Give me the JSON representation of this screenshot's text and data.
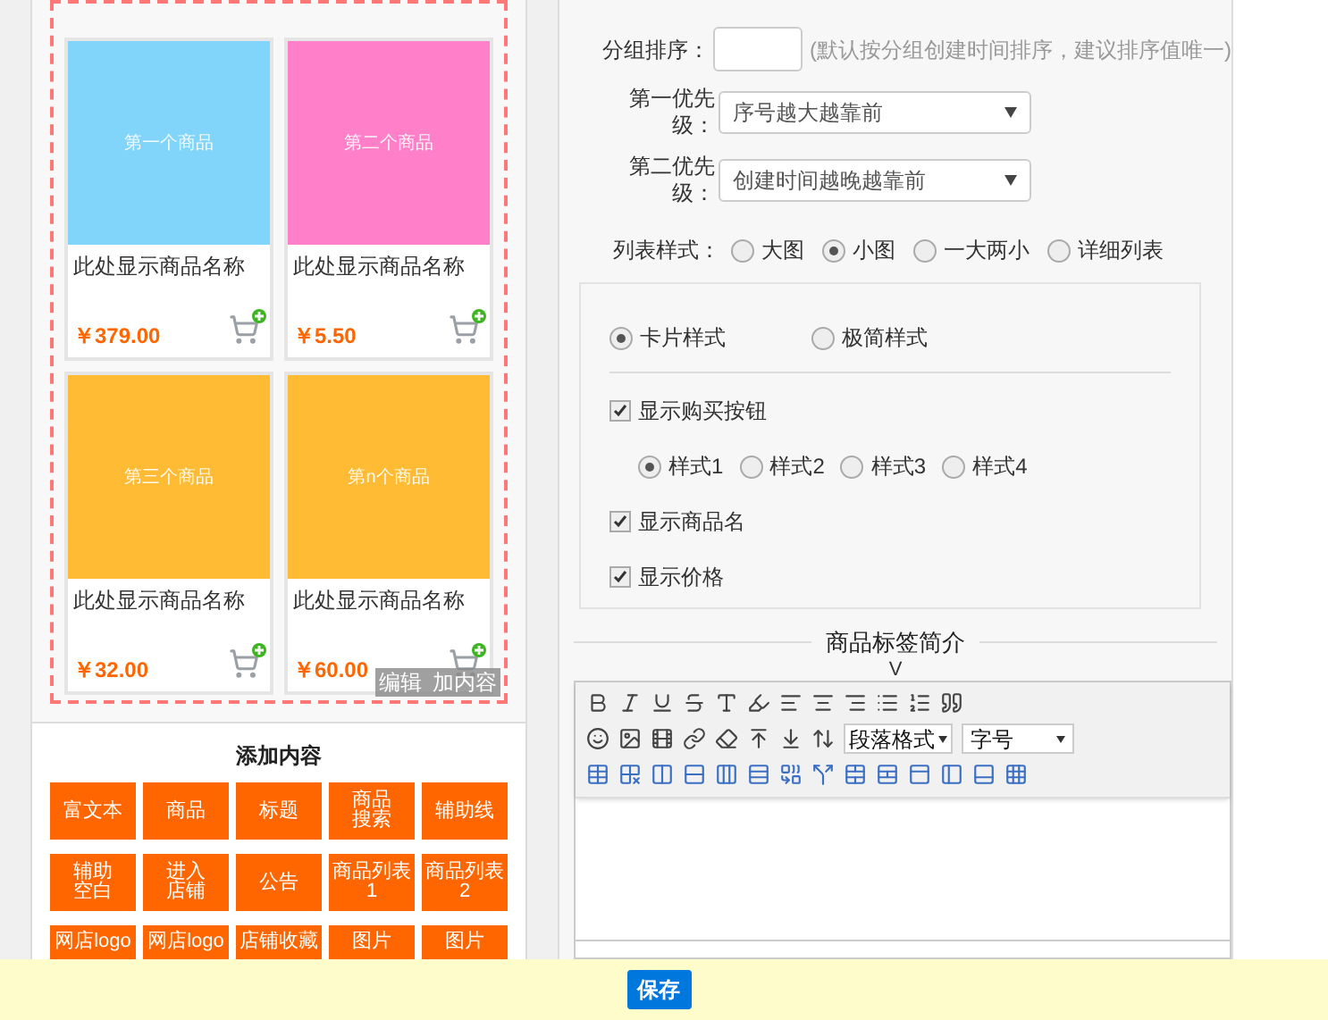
{
  "preview": {
    "products": [
      {
        "image_label": "第一个商品",
        "color": "#81d4fa",
        "name": "此处显示商品名称",
        "price": "￥379.00"
      },
      {
        "image_label": "第二个商品",
        "color": "#ff80c8",
        "name": "此处显示商品名称",
        "price": "￥5.50"
      },
      {
        "image_label": "第三个商品",
        "color": "#ffbb33",
        "name": "此处显示商品名称",
        "price": "￥32.00"
      },
      {
        "image_label": "第n个商品",
        "color": "#ffbb33",
        "name": "此处显示商品名称",
        "price": "￥60.00"
      }
    ],
    "overlay_actions": [
      "编辑",
      "加内容"
    ]
  },
  "add_content": {
    "title": "添加内容",
    "buttons": [
      {
        "lines": [
          "富文本"
        ]
      },
      {
        "lines": [
          "商品"
        ]
      },
      {
        "lines": [
          "标题"
        ]
      },
      {
        "lines": [
          "商品",
          "搜索"
        ]
      },
      {
        "lines": [
          "辅助线"
        ]
      },
      {
        "lines": [
          "辅助",
          "空白"
        ]
      },
      {
        "lines": [
          "进入",
          "店铺"
        ]
      },
      {
        "lines": [
          "公告"
        ]
      },
      {
        "lines": [
          "商品列表",
          "1"
        ]
      },
      {
        "lines": [
          "商品列表",
          "2"
        ]
      },
      {
        "lines": [
          "网店logo"
        ],
        "cut": true
      },
      {
        "lines": [
          "网店logo"
        ],
        "cut": true
      },
      {
        "lines": [
          "店铺收藏"
        ],
        "cut": true
      },
      {
        "lines": [
          "图片"
        ],
        "cut": true
      },
      {
        "lines": [
          "图片"
        ],
        "cut": true
      }
    ]
  },
  "settings": {
    "group_order": {
      "label": "分组排序：",
      "hint": "(默认按分组创建时间排序，建议排序值唯一)"
    },
    "priorities": [
      {
        "label": "第一优先级：",
        "value": "序号越大越靠前"
      },
      {
        "label": "第二优先级：",
        "value": "创建时间越晚越靠前"
      }
    ],
    "list_style": {
      "label": "列表样式：",
      "options": [
        {
          "label": "大图",
          "selected": false
        },
        {
          "label": "小图",
          "selected": true
        },
        {
          "label": "一大两小",
          "selected": false
        },
        {
          "label": "详细列表",
          "selected": false
        }
      ]
    },
    "card_style": [
      {
        "label": "卡片样式",
        "selected": true
      },
      {
        "label": "极简样式",
        "selected": false
      }
    ],
    "show_buy_button": {
      "label": "显示购买按钮",
      "checked": true
    },
    "buy_styles": [
      {
        "label": "样式1",
        "selected": true
      },
      {
        "label": "样式2",
        "selected": false
      },
      {
        "label": "样式3",
        "selected": false
      },
      {
        "label": "样式4",
        "selected": false
      }
    ],
    "show_name": {
      "label": "显示商品名",
      "checked": true
    },
    "show_price": {
      "label": "显示价格",
      "checked": true
    }
  },
  "editor": {
    "title": "商品标签简介",
    "marker": "V",
    "paragraph_select": "段落格式",
    "size_select": "字号"
  },
  "save_button": "保存"
}
